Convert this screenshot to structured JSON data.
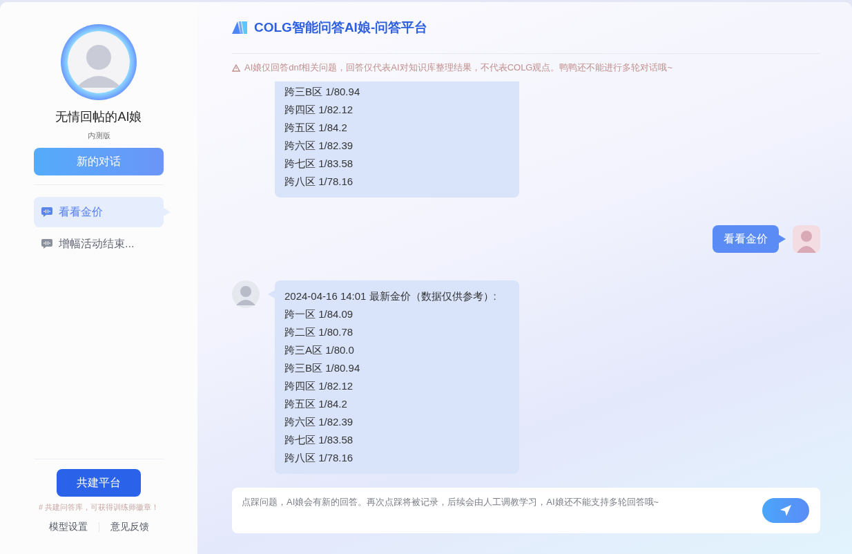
{
  "sidebar": {
    "bot_name": "无情回帖的AI娘",
    "version": "内测版",
    "new_chat_button": "新的对话",
    "conversations": [
      {
        "title": "看看金价",
        "selected": true
      },
      {
        "title": "增幅活动结束...",
        "selected": false
      }
    ],
    "build_button": "共建平台",
    "build_hint": "# 共建问答库，可获得训练师徽章！",
    "links": [
      "模型设置",
      "意见反馈"
    ]
  },
  "header": {
    "title": "COLG智能问答AI娘-问答平台",
    "notice": "AI娘仅回答dnf相关问题，回答仅代表AI对知识库整理结果，不代表COLG观点。鸭鸭还不能进行多轮对话哦~"
  },
  "messages": [
    {
      "kind": "bot",
      "cut": true,
      "lines": [
        "跨三B区 1/80.94",
        "跨四区 1/82.12",
        "跨五区 1/84.2",
        "跨六区 1/82.39",
        "跨七区 1/83.58",
        "跨八区 1/78.16"
      ]
    },
    {
      "kind": "user",
      "lines": [
        "看看金价"
      ]
    },
    {
      "kind": "bot",
      "cut": false,
      "lines": [
        "2024-04-16 14:01 最新金价（数据仅供参考）:",
        "跨一区 1/84.09",
        "跨二区 1/80.78",
        "跨三A区 1/80.0",
        "跨三B区 1/80.94",
        "跨四区 1/82.12",
        "跨五区 1/84.2",
        "跨六区 1/82.39",
        "跨七区 1/83.58",
        "跨八区 1/78.16"
      ]
    }
  ],
  "input": {
    "placeholder": "点踩问题，AI娘会有新的回答。再次点踩将被记录，后续会由人工调教学习，AI娘还不能支持多轮回答哦~"
  }
}
